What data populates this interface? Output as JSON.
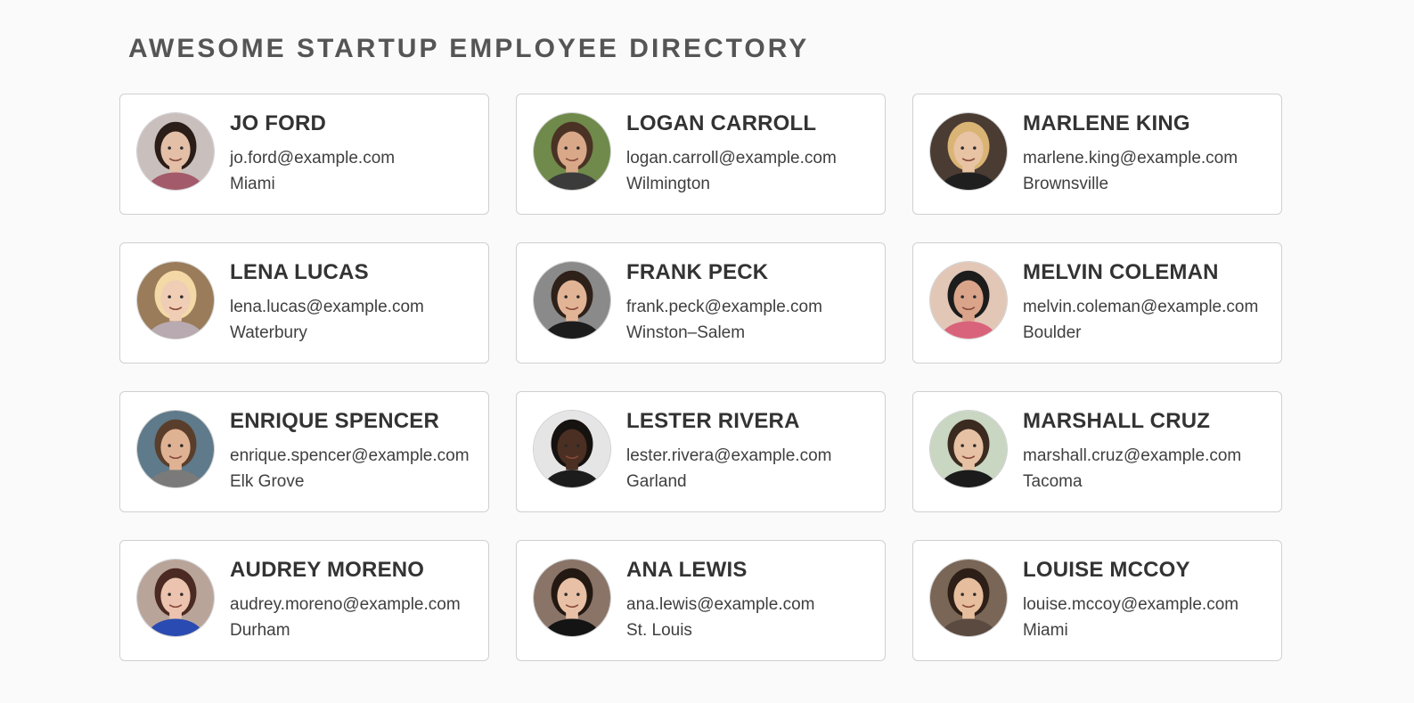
{
  "page": {
    "title": "AWESOME STARTUP EMPLOYEE DIRECTORY"
  },
  "employees": [
    {
      "name": "JO FORD",
      "email": "jo.ford@example.com",
      "city": "Miami",
      "bg": "#c9c0bd",
      "skin": "#e3bfa8",
      "hair": "#2b1d17",
      "shirt": "#a35a6a"
    },
    {
      "name": "LOGAN CARROLL",
      "email": "logan.carroll@example.com",
      "city": "Wilmington",
      "bg": "#6f8a4a",
      "skin": "#d9a889",
      "hair": "#4a3224",
      "shirt": "#3b3b3b"
    },
    {
      "name": "MARLENE KING",
      "email": "marlene.king@example.com",
      "city": "Brownsville",
      "bg": "#4a3b33",
      "skin": "#e8c3a4",
      "hair": "#d9b474",
      "shirt": "#1f1f1f"
    },
    {
      "name": "LENA LUCAS",
      "email": "lena.lucas@example.com",
      "city": "Waterbury",
      "bg": "#9a7b5a",
      "skin": "#f0cdb5",
      "hair": "#f2d9a6",
      "shirt": "#b8aab0"
    },
    {
      "name": "FRANK PECK",
      "email": "frank.peck@example.com",
      "city": "Winston–Salem",
      "bg": "#8a8a8a",
      "skin": "#e2b496",
      "hair": "#2e2119",
      "shirt": "#1c1c1c"
    },
    {
      "name": "MELVIN COLEMAN",
      "email": "melvin.coleman@example.com",
      "city": "Boulder",
      "bg": "#e2c7b7",
      "skin": "#d9a48a",
      "hair": "#1c1c1c",
      "shirt": "#d9637a"
    },
    {
      "name": "ENRIQUE SPENCER",
      "email": "enrique.spencer@example.com",
      "city": "Elk Grove",
      "bg": "#5f7a8a",
      "skin": "#e0b294",
      "hair": "#5a3e2c",
      "shirt": "#7a7a7a"
    },
    {
      "name": "LESTER RIVERA",
      "email": "lester.rivera@example.com",
      "city": "Garland",
      "bg": "#e5e5e5",
      "skin": "#4a2f22",
      "hair": "#161210",
      "shirt": "#1c1c1c"
    },
    {
      "name": "MARSHALL CRUZ",
      "email": "marshall.cruz@example.com",
      "city": "Tacoma",
      "bg": "#c8d6c2",
      "skin": "#e6c1a4",
      "hair": "#3a2a20",
      "shirt": "#1b1b1b"
    },
    {
      "name": "AUDREY MORENO",
      "email": "audrey.moreno@example.com",
      "city": "Durham",
      "bg": "#b9a49a",
      "skin": "#ecc3ae",
      "hair": "#4a2a22",
      "shirt": "#2a4bb2"
    },
    {
      "name": "ANA LEWIS",
      "email": "ana.lewis@example.com",
      "city": "St. Louis",
      "bg": "#8a7468",
      "skin": "#e8c0a5",
      "hair": "#241812",
      "shirt": "#141414"
    },
    {
      "name": "LOUISE MCCOY",
      "email": "louise.mccoy@example.com",
      "city": "Miami",
      "bg": "#7a6656",
      "skin": "#e6be9e",
      "hair": "#2d1f17",
      "shirt": "#5a4a40"
    }
  ]
}
